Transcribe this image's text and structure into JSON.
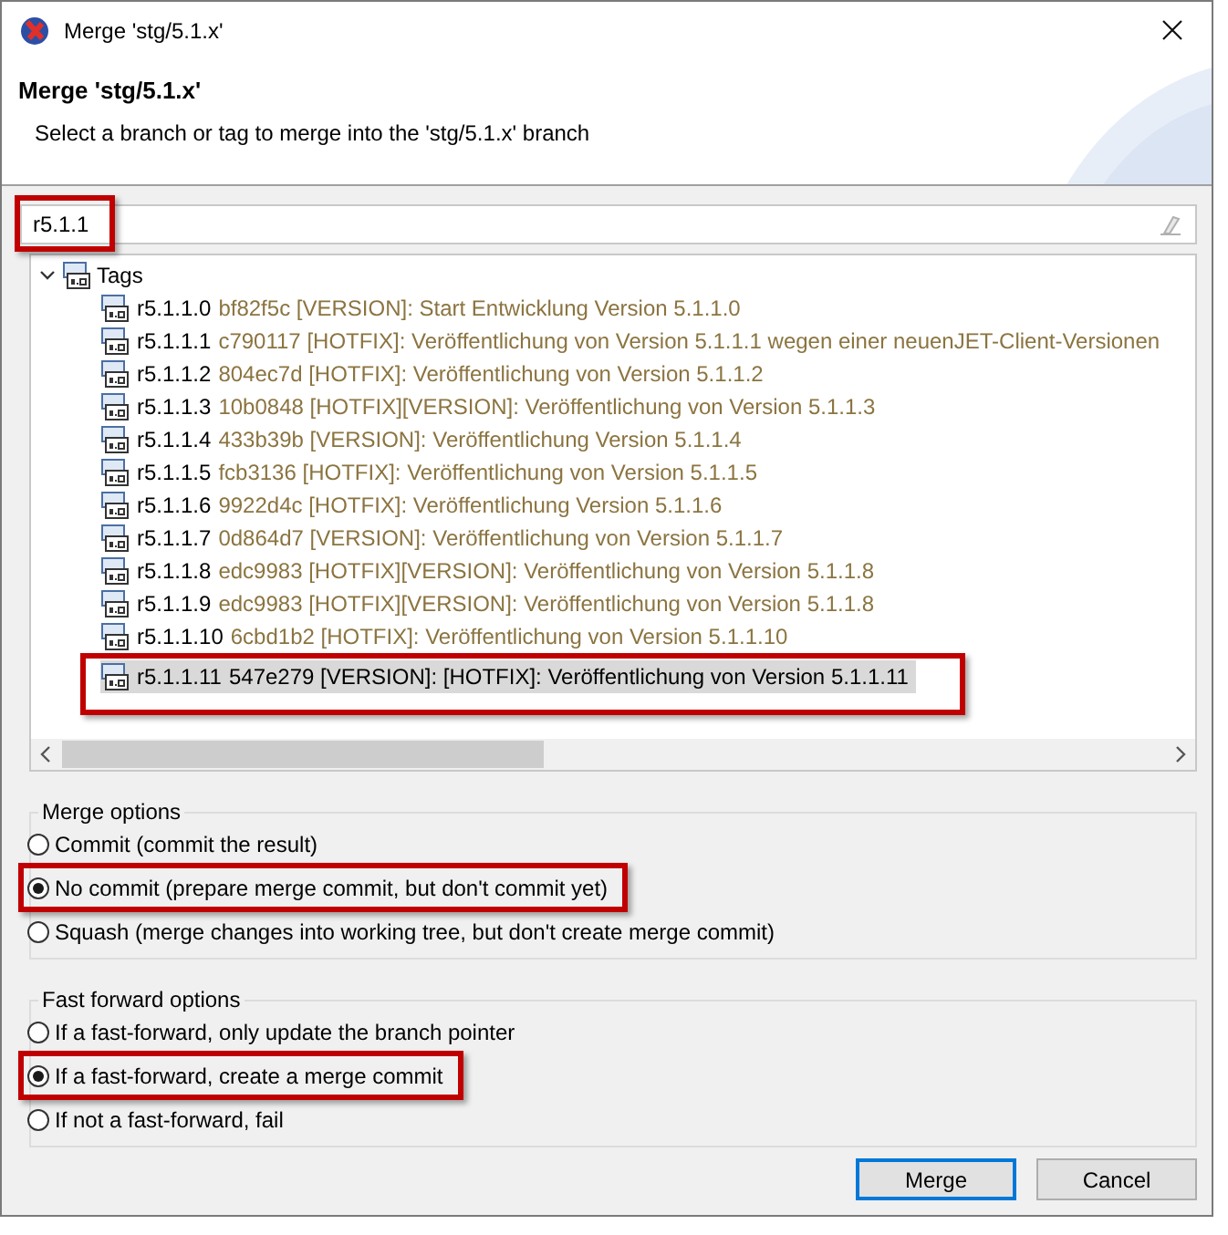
{
  "window": {
    "title": "Merge 'stg/5.1.x'"
  },
  "header": {
    "title": "Merge 'stg/5.1.x'",
    "subtitle": "Select a branch or tag to merge into the 'stg/5.1.x' branch"
  },
  "filter": {
    "value": "r5.1.1",
    "highlighted": true
  },
  "tree": {
    "groups": [
      {
        "label": "Tags",
        "expanded": true,
        "children": [
          {
            "name": "r5.1.1.0",
            "detail": "bf82f5c [VERSION]: Start Entwicklung Version 5.1.1.0",
            "selected": false,
            "highlighted": false
          },
          {
            "name": "r5.1.1.1",
            "detail": "c790117 [HOTFIX]: Veröffentlichung von Version 5.1.1.1 wegen einer neuenJET-Client-Versionen",
            "selected": false,
            "highlighted": false
          },
          {
            "name": "r5.1.1.2",
            "detail": "804ec7d [HOTFIX]: Veröffentlichung von Version 5.1.1.2",
            "selected": false,
            "highlighted": false
          },
          {
            "name": "r5.1.1.3",
            "detail": "10b0848 [HOTFIX][VERSION]: Veröffentlichung von Version 5.1.1.3",
            "selected": false,
            "highlighted": false
          },
          {
            "name": "r5.1.1.4",
            "detail": "433b39b [VERSION]: Veröffentlichung Version 5.1.1.4",
            "selected": false,
            "highlighted": false
          },
          {
            "name": "r5.1.1.5",
            "detail": "fcb3136 [HOTFIX]: Veröffentlichung von Version 5.1.1.5",
            "selected": false,
            "highlighted": false
          },
          {
            "name": "r5.1.1.6",
            "detail": "9922d4c [HOTFIX]: Veröffentlichung Version 5.1.1.6",
            "selected": false,
            "highlighted": false
          },
          {
            "name": "r5.1.1.7",
            "detail": "0d864d7 [VERSION]: Veröffentlichung von Version 5.1.1.7",
            "selected": false,
            "highlighted": false
          },
          {
            "name": "r5.1.1.8",
            "detail": "edc9983 [HOTFIX][VERSION]: Veröffentlichung von Version 5.1.1.8",
            "selected": false,
            "highlighted": false
          },
          {
            "name": "r5.1.1.9",
            "detail": "edc9983 [HOTFIX][VERSION]: Veröffentlichung von Version 5.1.1.8",
            "selected": false,
            "highlighted": false
          },
          {
            "name": "r5.1.1.10",
            "detail": "6cbd1b2 [HOTFIX]: Veröffentlichung von Version 5.1.1.10",
            "selected": false,
            "highlighted": false
          },
          {
            "name": "r5.1.1.11",
            "detail": "547e279 [VERSION]: [HOTFIX]: Veröffentlichung von Version 5.1.1.11",
            "selected": true,
            "highlighted": true
          }
        ]
      }
    ]
  },
  "merge_options": {
    "title": "Merge options",
    "options": [
      {
        "label": "Commit (commit the result)",
        "selected": false,
        "highlighted": false
      },
      {
        "label": "No commit (prepare merge commit, but don't commit yet)",
        "selected": true,
        "highlighted": true
      },
      {
        "label": "Squash (merge changes into working tree, but don't create merge commit)",
        "selected": false,
        "highlighted": false
      }
    ]
  },
  "fast_forward_options": {
    "title": "Fast forward options",
    "options": [
      {
        "label": "If a fast-forward, only update the branch pointer",
        "selected": false,
        "highlighted": false
      },
      {
        "label": "If a fast-forward, create a merge commit",
        "selected": true,
        "highlighted": true
      },
      {
        "label": "If not a fast-forward, fail",
        "selected": false,
        "highlighted": false
      }
    ]
  },
  "buttons": [
    {
      "label": "Merge",
      "default": true
    },
    {
      "label": "Cancel",
      "default": false
    }
  ]
}
